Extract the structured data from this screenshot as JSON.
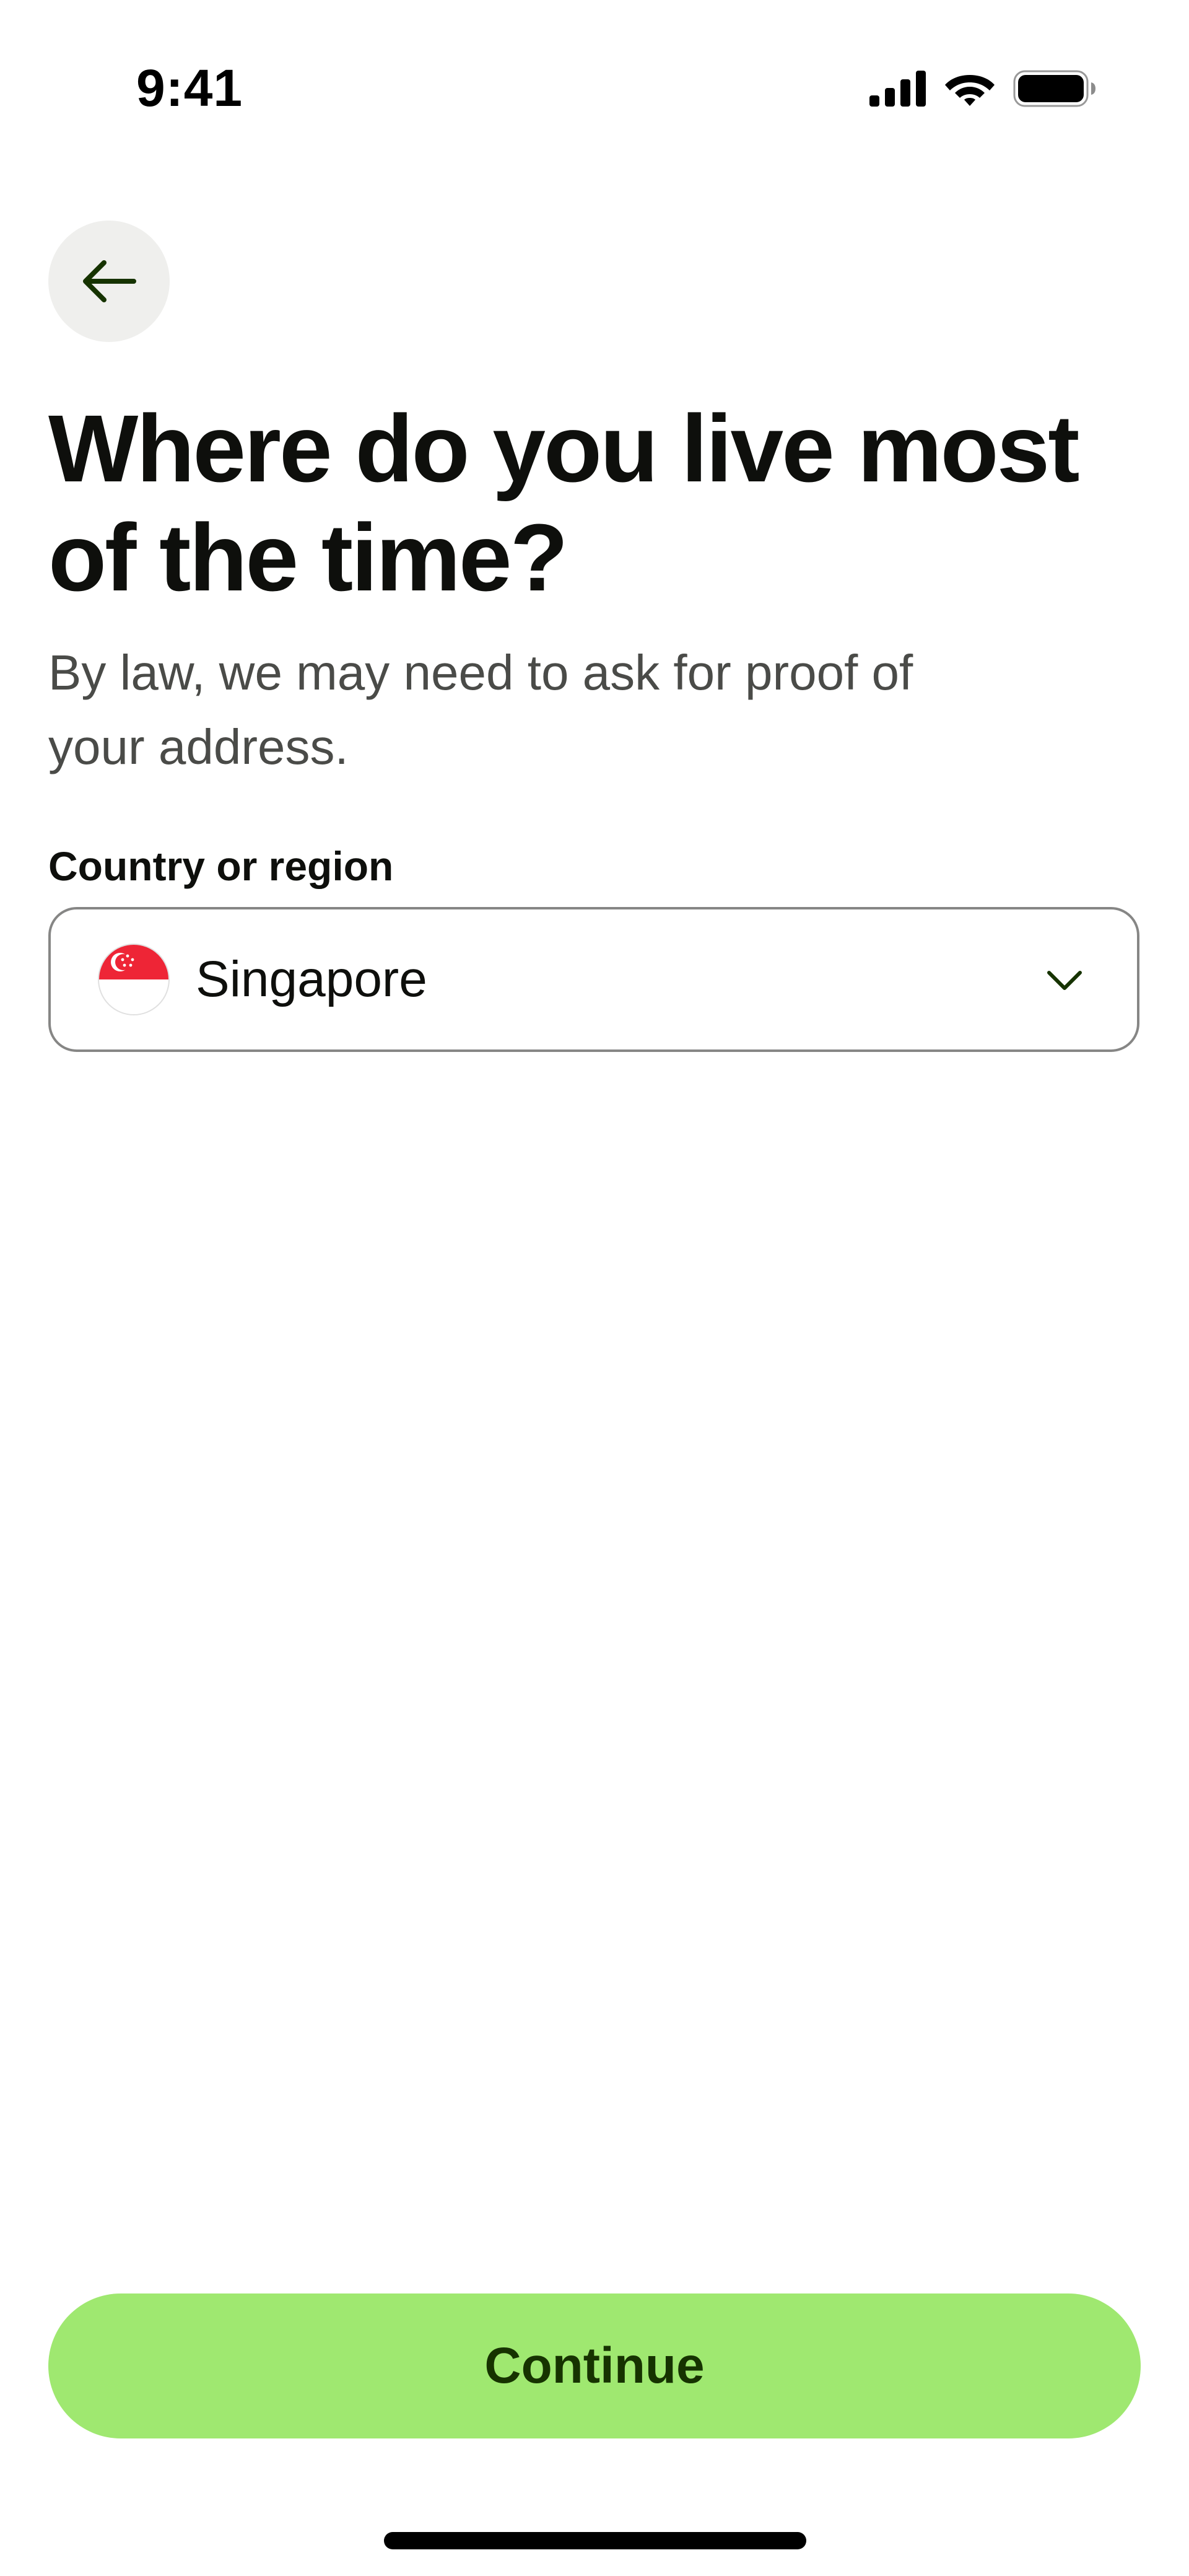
{
  "status_bar": {
    "time": "9:41",
    "icons": [
      "cellular-signal-icon",
      "wifi-icon",
      "battery-icon"
    ]
  },
  "nav": {
    "back_icon": "arrow-left-icon"
  },
  "content": {
    "title": "Where do you live most of the time?",
    "subtitle": "By law, we may need to ask for proof of your address."
  },
  "country_field": {
    "label": "Country or region",
    "value": "Singapore",
    "flag_icon": "singapore-flag-icon",
    "chevron_icon": "chevron-down-icon"
  },
  "actions": {
    "continue_label": "Continue"
  },
  "colors": {
    "accent": "#9fe870",
    "accent_text": "#163300",
    "back_button_bg": "#efefed",
    "field_border": "#868685",
    "text_primary": "#0e0f0c",
    "text_secondary": "#4a4b48",
    "flag_red": "#ee2536"
  }
}
